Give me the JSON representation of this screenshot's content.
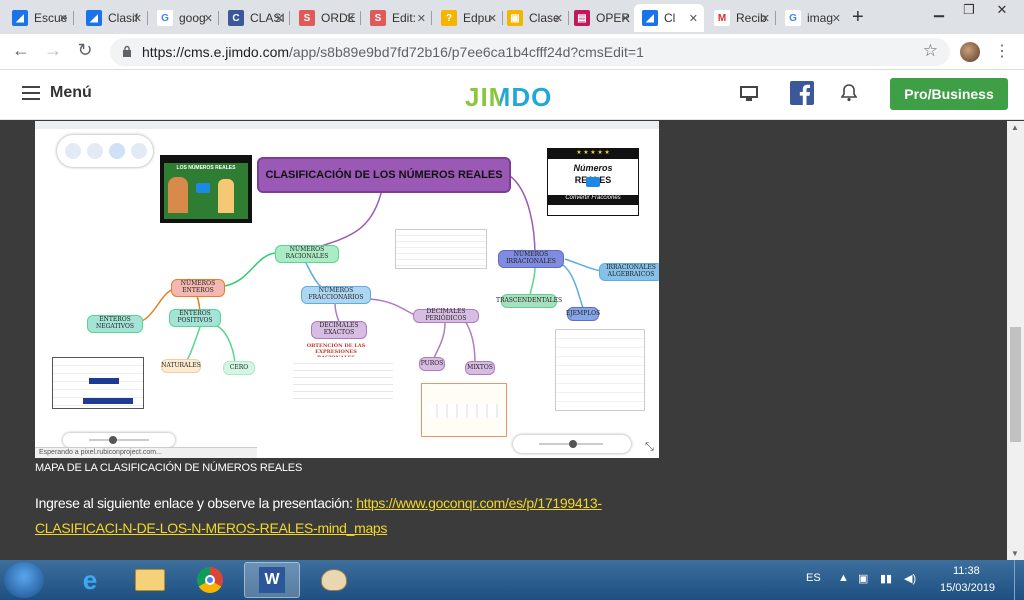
{
  "browser": {
    "tabs": [
      {
        "label": "Escue",
        "icon": "jimdo-icon",
        "color": "#1a73e8"
      },
      {
        "label": "Clasif",
        "icon": "jimdo-icon",
        "color": "#1a73e8"
      },
      {
        "label": "goog",
        "icon": "google-icon",
        "color": "#4285f4"
      },
      {
        "label": "CLASI",
        "icon": "copyleaks-icon",
        "color": "#3b5998"
      },
      {
        "label": "ORDE",
        "icon": "slides-icon",
        "color": "#e05a5a"
      },
      {
        "label": "Edit:",
        "icon": "slides-icon",
        "color": "#e05a5a"
      },
      {
        "label": "Edpu",
        "icon": "edpuzzle-icon",
        "color": "#f4b400"
      },
      {
        "label": "Clase",
        "icon": "classroom-icon",
        "color": "#f4b400"
      },
      {
        "label": "OPER",
        "icon": "form-icon",
        "color": "#c2185b"
      },
      {
        "label": "Cl",
        "icon": "jimdo-icon",
        "color": "#1a73e8"
      },
      {
        "label": "Recib",
        "icon": "gmail-icon",
        "color": "#d93025"
      },
      {
        "label": "imag",
        "icon": "google-icon",
        "color": "#4285f4"
      }
    ],
    "new_tab": "+",
    "url_host": "https://cms.e.jimdo.com",
    "url_path": "/app/s8b89e9bd7fd72b16/p7ee6ca1b4cfff24d?cmsEdit=1"
  },
  "jimdo": {
    "menu_label": "Menú",
    "logo": "JIMDO",
    "pro_button": "Pro/Business"
  },
  "mindmap": {
    "title": "CLASIFICACIÓN DE LOS NÚMEROS REALES",
    "video_left_title": "LOS NÚMEROS REALES",
    "video_right_line1": "Números",
    "video_right_line2": "REALES",
    "video_right_line3": "Convertir Fracciones",
    "nodes": {
      "racionales": "NÚMEROS RACIONALES",
      "enteros": "NÚMEROS ENTEROS",
      "enteros_neg": "ENTEROS NEGATIVOS",
      "enteros_pos": "ENTEROS POSITIVOS",
      "naturales": "NATURALES",
      "cero": "CERO",
      "fraccionarios": "NÚMEROS FRACCIONARIOS",
      "dec_exactos": "DECIMALES EXACTOS",
      "dec_periodicos": "DECIMALES PERIÓDICOS",
      "puros": "PUROS",
      "mixtos": "MIXTOS",
      "irracionales": "NÚMEROS IRRACIONALES",
      "trascendentales": "TRASCENDENTALES",
      "ejemplos": "EJEMPLOS",
      "irr_algebraicos": "IRRACIONALES ALGEBRAICOS",
      "obtencion": "OBTENCIÓN DE LAS EXPRESIONES RACIONALES"
    },
    "status": "Esperando a pixel.rubiconproject.com..."
  },
  "content": {
    "caption": "MAPA DE LA CLASIFICACIÓN DE NÚMEROS REALES",
    "instruction": "Ingrese al siguiente enlace y observe la presentación: ",
    "link": "https://www.goconqr.com/es/p/17199413-CLASIFICACI-N-DE-LOS-N-MEROS-REALES-mind_maps"
  },
  "taskbar": {
    "language": "ES",
    "time": "11:38",
    "date": "15/03/2019"
  },
  "colors": {
    "jimdo_green": "#3e9f46",
    "link_yellow": "#f2d82a",
    "title_node": "#9b59b6"
  }
}
